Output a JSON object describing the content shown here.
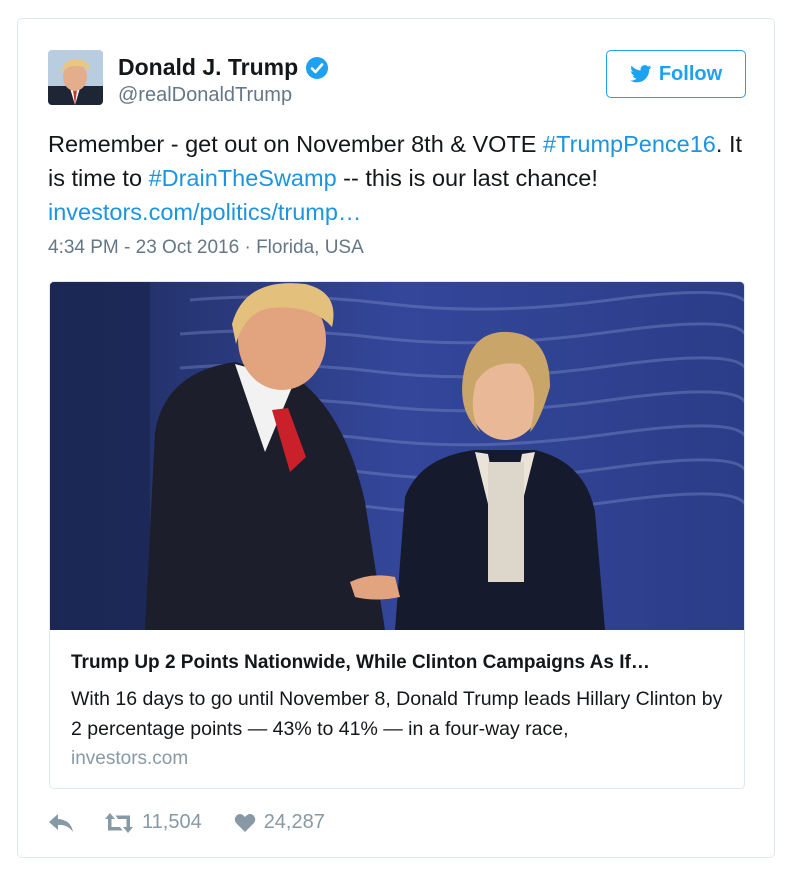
{
  "user": {
    "name": "Donald J. Trump",
    "handle": "@realDonaldTrump",
    "verified_icon": "verified-badge-icon"
  },
  "follow_button": {
    "label": "Follow",
    "icon": "twitter-bird-icon"
  },
  "tweet": {
    "text_part1": "Remember - get out on November 8th & VOTE ",
    "hashtag1": "#TrumpPence16",
    "text_part2": ". It is time to ",
    "hashtag2": "#DrainTheSwamp",
    "text_part3": " -- this is our last chance! ",
    "link": "investors.com/politics/trump…",
    "timestamp": "4:34 PM - 23 Oct 2016",
    "separator": " · ",
    "location": "Florida, USA"
  },
  "card": {
    "title": "Trump Up 2 Points Nationwide, While Clinton Campaigns As If…",
    "description": "With 16 days to go until November 8, Donald Trump leads Hillary Clinton by 2 percentage points — 43% to 41% — in a four-way race,",
    "domain": "investors.com"
  },
  "actions": {
    "reply_icon": "reply-icon",
    "retweet_count": "11,504",
    "like_count": "24,287"
  },
  "colors": {
    "link": "#1b95e0",
    "follow": "#1da1f2",
    "muted": "#657786",
    "border": "#e1e8ed"
  }
}
